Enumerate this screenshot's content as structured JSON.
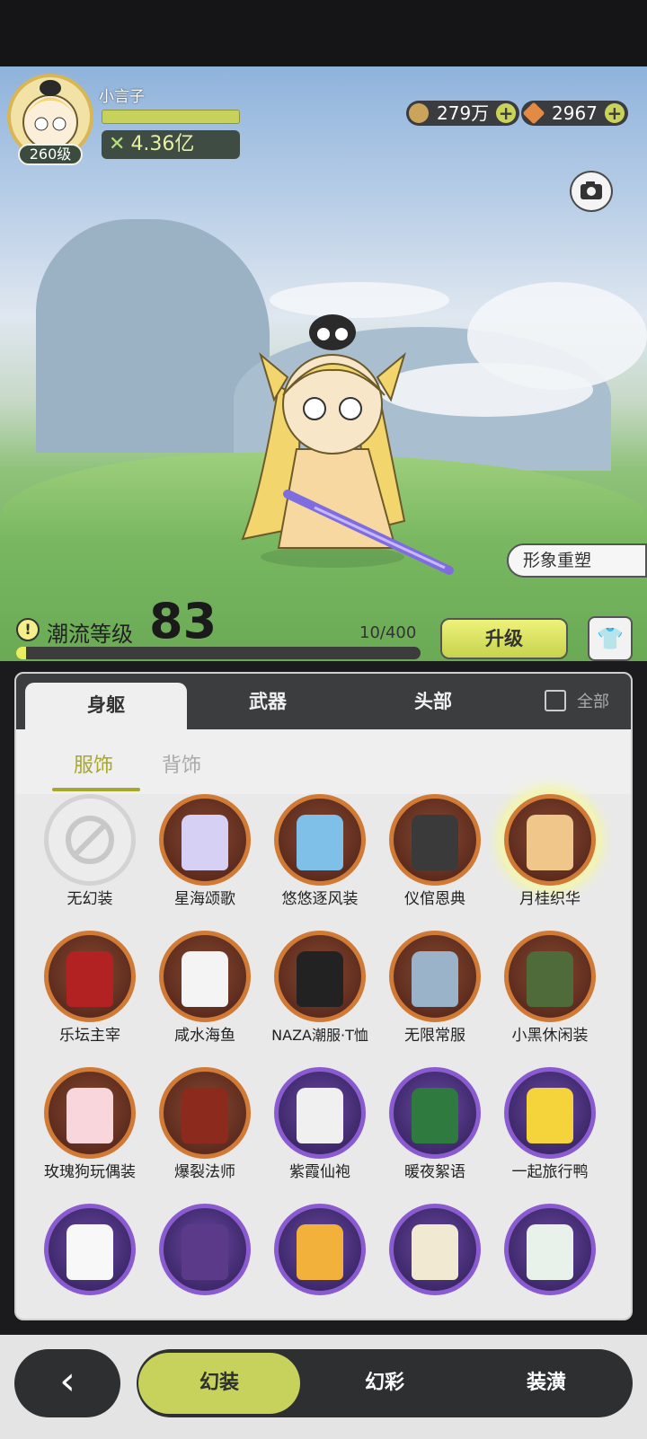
{
  "player": {
    "name": "小言子",
    "level": "260级",
    "power": "4.36亿"
  },
  "currencies": [
    {
      "name": "gold",
      "value": "279万",
      "color": "#c9a45a"
    },
    {
      "name": "crystal",
      "value": "2967",
      "color": "#e38a45"
    }
  ],
  "scene": {
    "reshape_label": "形象重塑"
  },
  "trend": {
    "label": "潮流等级",
    "level": "83",
    "progress": "10/400",
    "progress_fraction": 0.025,
    "upgrade_label": "升级"
  },
  "tabs": [
    "身躯",
    "武器",
    "头部"
  ],
  "all_label": "全部",
  "subtabs": [
    "服饰",
    "背饰"
  ],
  "items": [
    {
      "label": "无幻装",
      "rarity": "none"
    },
    {
      "label": "星海颂歌",
      "rarity": "orange"
    },
    {
      "label": "悠悠逐风装",
      "rarity": "orange"
    },
    {
      "label": "仪倌恩典",
      "rarity": "orange"
    },
    {
      "label": "月桂织华",
      "rarity": "orange"
    },
    {
      "label": "乐坛主宰",
      "rarity": "orange"
    },
    {
      "label": "咸水海鱼",
      "rarity": "orange"
    },
    {
      "label": "NAZA潮服·T恤",
      "rarity": "orange"
    },
    {
      "label": "无限常服",
      "rarity": "orange"
    },
    {
      "label": "小黑休闲装",
      "rarity": "orange"
    },
    {
      "label": "玫瑰狗玩偶装",
      "rarity": "orange"
    },
    {
      "label": "爆裂法师",
      "rarity": "orange"
    },
    {
      "label": "紫霞仙袍",
      "rarity": "purple"
    },
    {
      "label": "暖夜絮语",
      "rarity": "purple"
    },
    {
      "label": "一起旅行鸭",
      "rarity": "purple"
    },
    {
      "label": "",
      "rarity": "purple"
    },
    {
      "label": "",
      "rarity": "purple"
    },
    {
      "label": "",
      "rarity": "purple"
    },
    {
      "label": "",
      "rarity": "purple"
    },
    {
      "label": "",
      "rarity": "purple"
    }
  ],
  "bottom_nav": [
    "幻装",
    "幻彩",
    "装潢"
  ]
}
